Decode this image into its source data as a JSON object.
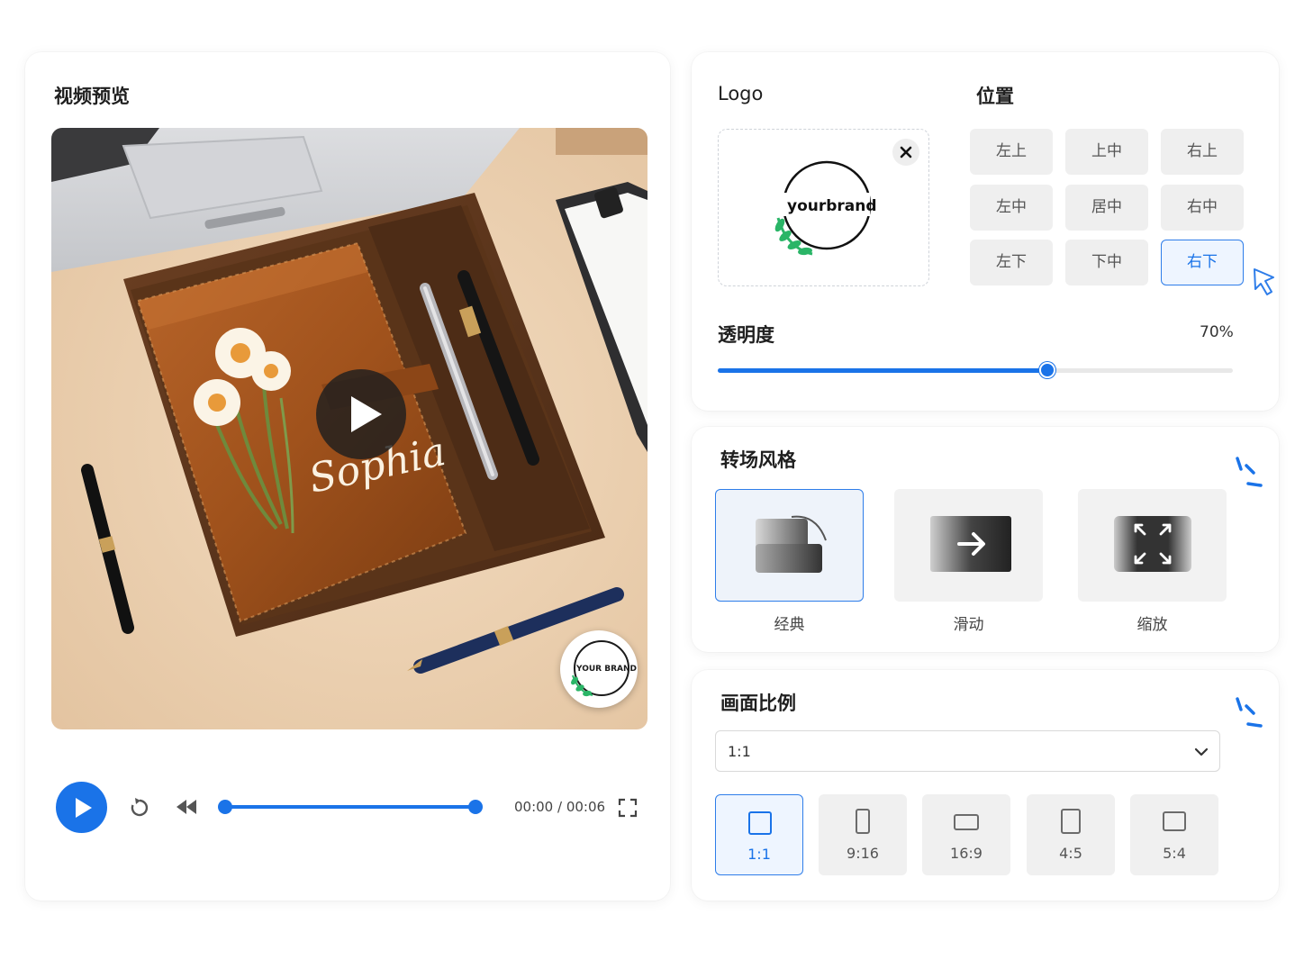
{
  "colors": {
    "accent": "#1a73e8",
    "tile_bg": "#efefef",
    "card_bg": "#ffffff"
  },
  "preview": {
    "title": "视频预览",
    "video_script_text": "Sophia",
    "watermark_text": "YOUR BRAND",
    "controls": {
      "play_icon": "play-icon",
      "replay_icon": "replay-icon",
      "rewind_icon": "rewind-icon",
      "fullscreen_icon": "fullscreen-icon",
      "seek_progress": 1.0,
      "time": "00:00 / 00:06"
    }
  },
  "logo": {
    "title": "Logo",
    "brand_text": "yourbrand",
    "close_icon": "close-icon"
  },
  "position": {
    "title": "位置",
    "options": [
      "左上",
      "上中",
      "右上",
      "左中",
      "居中",
      "右中",
      "左下",
      "下中",
      "右下"
    ],
    "selected": "右下"
  },
  "opacity": {
    "title": "透明度",
    "value_text": "70%",
    "value": 0.64
  },
  "transition": {
    "title": "转场风格",
    "styles": [
      {
        "label": "经典",
        "icon": "classic-transition-icon"
      },
      {
        "label": "滑动",
        "icon": "slide-arrow-icon"
      },
      {
        "label": "缩放",
        "icon": "zoom-expand-icon"
      }
    ],
    "selected": "经典"
  },
  "ratio": {
    "title": "画面比例",
    "selected_value": "1:1",
    "options": [
      "1:1",
      "9:16",
      "16:9",
      "4:5",
      "5:4"
    ]
  }
}
